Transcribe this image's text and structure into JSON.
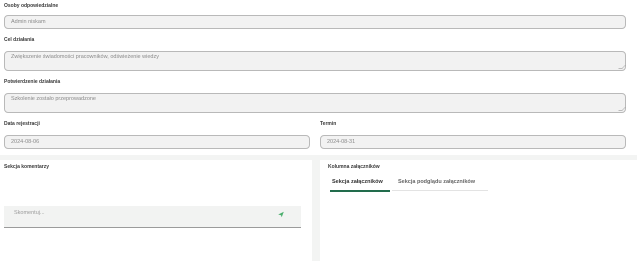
{
  "form": {
    "responsible_label": "Osoby odpowiedzialne",
    "responsible_value": "Admin niskam",
    "goal_label": "Cel działania",
    "goal_value": "Zwiększenie świadomości pracowników, odświeżenie wiedzy",
    "confirmation_label": "Potwierdzenie działania",
    "confirmation_value": "Szkolenie zostało przeprowadzone",
    "registration_label": "Data rejestracji",
    "registration_value": "2024-08-06",
    "deadline_label": "Termin",
    "deadline_value": "2024-08-31"
  },
  "comments": {
    "title": "Sekcja komentarzy",
    "placeholder": "Skomentuj...",
    "send_icon": "send-icon",
    "accent_color": "#4caf6e"
  },
  "attachments": {
    "title": "Kolumna załączników",
    "tabs": [
      {
        "label": "Sekcja załączników",
        "active": true
      },
      {
        "label": "Sekcja podglądu załączników",
        "active": false
      }
    ],
    "active_tab_color": "#226c4c"
  }
}
